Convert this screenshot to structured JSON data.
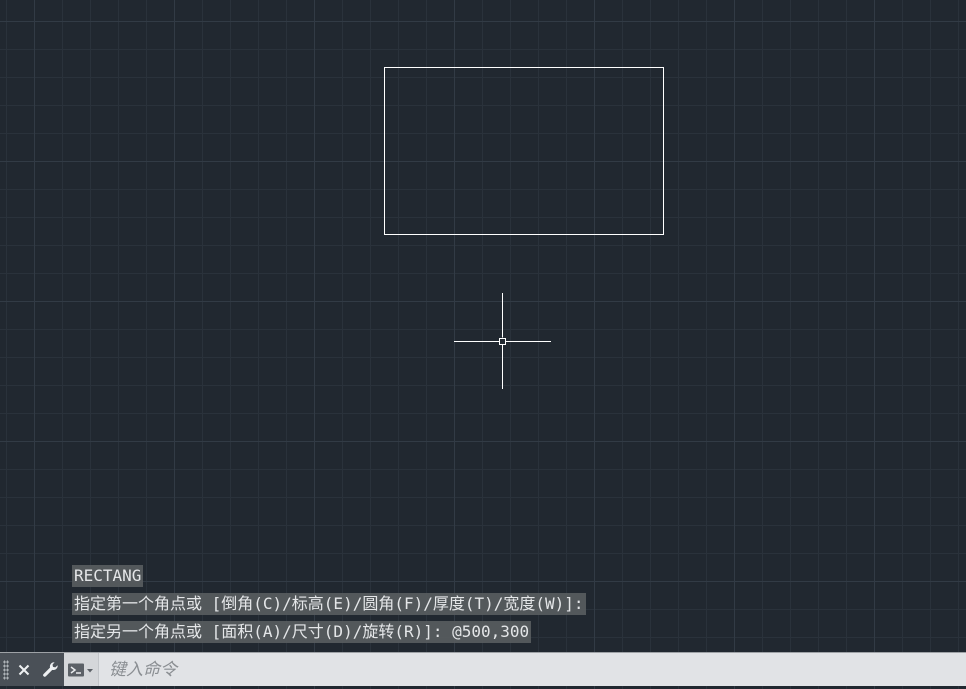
{
  "canvas": {
    "background": "#212830",
    "grid_minor_color": "#2a323b",
    "grid_major_color": "#323b45",
    "entity_color": "#ffffff",
    "cursor_color": "#ffffff"
  },
  "command_history": [
    "RECTANG",
    "指定第一个角点或 [倒角(C)/标高(E)/圆角(F)/厚度(T)/宽度(W)]:",
    "指定另一个角点或 [面积(A)/尺寸(D)/旋转(R)]: @500,300"
  ],
  "command_line": {
    "placeholder": "键入命令",
    "value": ""
  },
  "icons": {
    "close": "close-icon",
    "customize": "wrench-icon",
    "recent_commands": "command-prompt-icon"
  }
}
